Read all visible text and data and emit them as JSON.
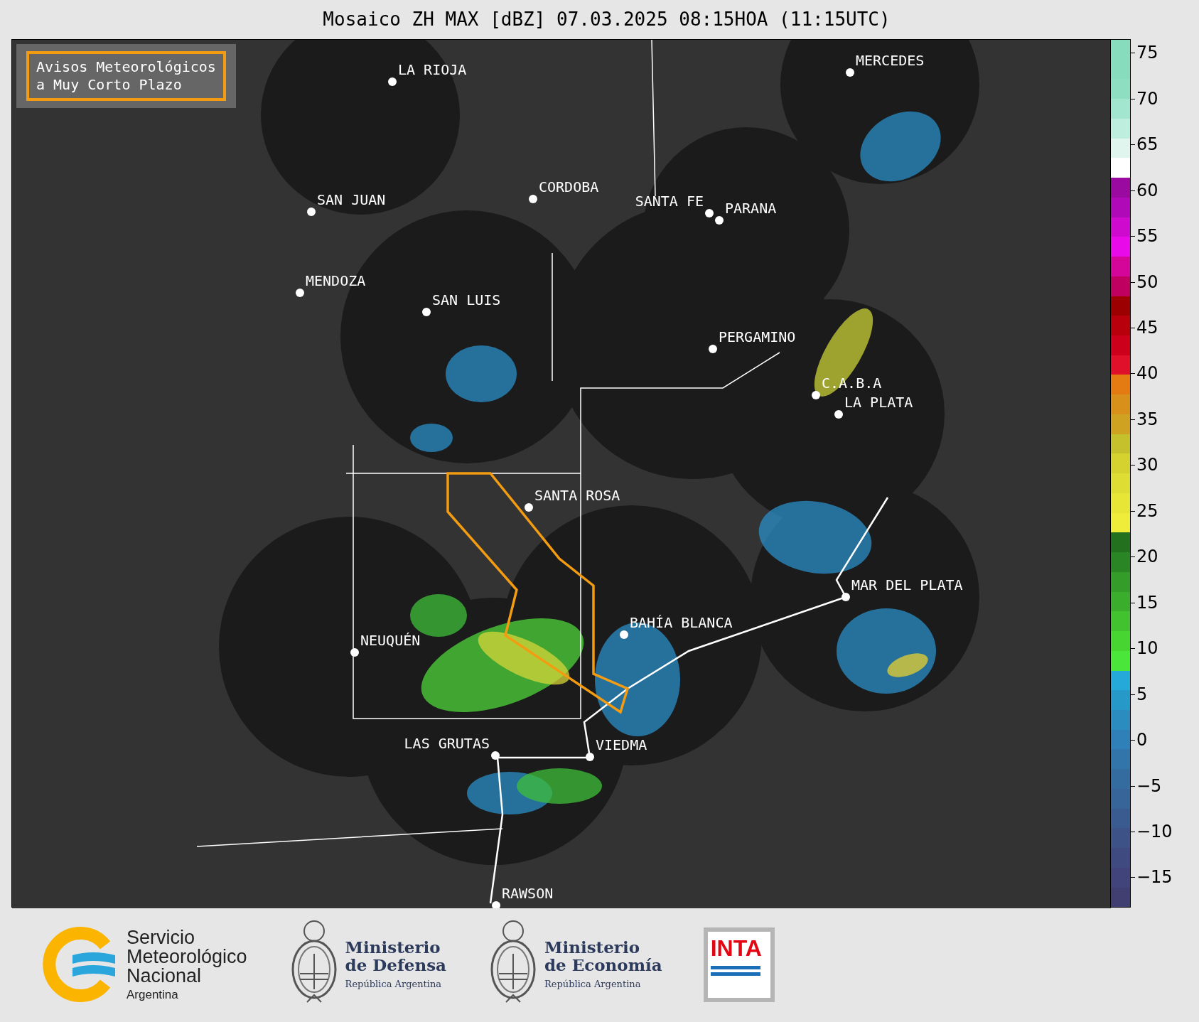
{
  "title": "Mosaico ZH MAX [dBZ] 07.03.2025 08:15HOA (11:15UTC)",
  "legend": {
    "lines": [
      "Avisos Meteorológicos",
      "a Muy Corto Plazo"
    ]
  },
  "map": {
    "cities": [
      {
        "name": "LA RIOJA"
      },
      {
        "name": "MERCEDES"
      },
      {
        "name": "SAN JUAN"
      },
      {
        "name": "CORDOBA"
      },
      {
        "name": "SANTA FE"
      },
      {
        "name": "PARANA"
      },
      {
        "name": "MENDOZA"
      },
      {
        "name": "SAN LUIS"
      },
      {
        "name": "PERGAMINO"
      },
      {
        "name": "C.A.B.A"
      },
      {
        "name": "LA PLATA"
      },
      {
        "name": "SANTA ROSA"
      },
      {
        "name": "MAR DEL PLATA"
      },
      {
        "name": "BAHÍA BLANCA"
      },
      {
        "name": "NEUQUÉN"
      },
      {
        "name": "LAS GRUTAS"
      },
      {
        "name": "VIEDMA"
      },
      {
        "name": "RAWSON"
      }
    ]
  },
  "colorbar": {
    "ticks": [
      "75",
      "70",
      "65",
      "60",
      "55",
      "50",
      "45",
      "40",
      "35",
      "30",
      "25",
      "20",
      "15",
      "10",
      "5",
      "0",
      "−5",
      "−10",
      "−15"
    ]
  },
  "footer": {
    "logos": [
      {
        "kind": "smn",
        "lines": [
          "Servicio",
          "Meteorológico",
          "Nacional"
        ],
        "subtitle": "Argentina"
      },
      {
        "kind": "ministry",
        "lines": [
          "Ministerio",
          "de Defensa"
        ],
        "subtitle": "República Argentina"
      },
      {
        "kind": "ministry",
        "lines": [
          "Ministerio",
          "de Economía"
        ],
        "subtitle": "República Argentina"
      },
      {
        "kind": "inta",
        "lines": [
          "INTA"
        ]
      }
    ]
  }
}
